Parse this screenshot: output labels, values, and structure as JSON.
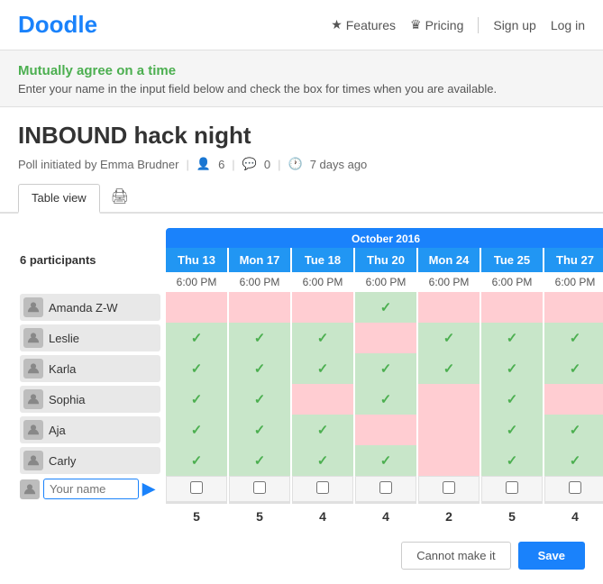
{
  "header": {
    "logo": "Doodle",
    "nav": [
      {
        "id": "features",
        "label": "Features",
        "icon": "★"
      },
      {
        "id": "pricing",
        "label": "Pricing",
        "icon": "♛"
      },
      {
        "id": "signup",
        "label": "Sign up"
      },
      {
        "id": "login",
        "label": "Log in"
      }
    ]
  },
  "hero": {
    "tagline": "Mutually agree on a time",
    "subtitle": "Enter your name in the input field below and check the box for times when you are available."
  },
  "poll": {
    "title": "INBOUND hack night",
    "meta": {
      "initiator": "Poll initiated by Emma Brudner",
      "participants_count": "6",
      "comments_count": "0",
      "time_ago": "7 days ago"
    }
  },
  "tabs": [
    {
      "id": "table-view",
      "label": "Table view",
      "active": true
    }
  ],
  "schedule": {
    "month": "October 2016",
    "columns": [
      {
        "id": "thu13",
        "day": "Thu 13",
        "time": "6:00 PM",
        "highlight": false
      },
      {
        "id": "mon17",
        "day": "Mon 17",
        "time": "6:00 PM",
        "highlight": false
      },
      {
        "id": "tue18",
        "day": "Tue 18",
        "time": "6:00 PM",
        "highlight": false
      },
      {
        "id": "thu20",
        "day": "Thu 20",
        "time": "6:00 PM",
        "highlight": false
      },
      {
        "id": "mon24",
        "day": "Mon 24",
        "time": "6:00 PM",
        "highlight": false
      },
      {
        "id": "tue25",
        "day": "Tue 25",
        "time": "6:00 PM",
        "highlight": false
      },
      {
        "id": "thu27",
        "day": "Thu 27",
        "time": "6:00 PM",
        "highlight": false
      }
    ],
    "participants_label": "6 participants",
    "participants": [
      {
        "name": "Amanda Z-W",
        "cells": [
          "empty",
          "empty",
          "empty",
          "check",
          "empty",
          "empty",
          "empty"
        ]
      },
      {
        "name": "Leslie",
        "cells": [
          "check",
          "check",
          "check",
          "empty",
          "check",
          "check",
          "check"
        ]
      },
      {
        "name": "Karla",
        "cells": [
          "check",
          "check",
          "check",
          "check",
          "check",
          "check",
          "check"
        ]
      },
      {
        "name": "Sophia",
        "cells": [
          "check",
          "check",
          "empty",
          "check",
          "empty",
          "check",
          "empty"
        ]
      },
      {
        "name": "Aja",
        "cells": [
          "check",
          "check",
          "check",
          "empty",
          "empty",
          "check",
          "check"
        ]
      },
      {
        "name": "Carly",
        "cells": [
          "check",
          "check",
          "check",
          "check",
          "empty",
          "check",
          "check"
        ]
      }
    ],
    "your_name_placeholder": "Your name",
    "counts": [
      "5",
      "5",
      "4",
      "4",
      "2",
      "5",
      "4"
    ]
  },
  "buttons": {
    "cannot_make_it": "Cannot make it",
    "save": "Save"
  }
}
